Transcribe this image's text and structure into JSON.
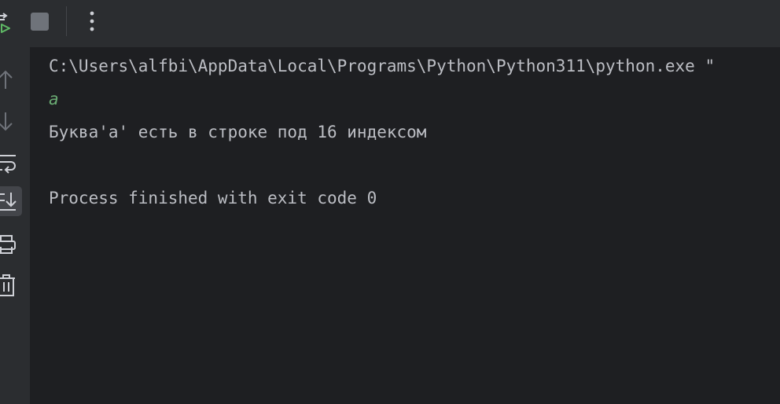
{
  "toolbar": {
    "buttons": [
      {
        "icon": "rerun-icon",
        "label": "Rerun"
      },
      {
        "icon": "stop-icon",
        "label": "Stop"
      },
      {
        "icon": "more-vertical-icon",
        "label": "More"
      }
    ]
  },
  "sidebar": {
    "items": [
      {
        "icon": "arrow-up-icon"
      },
      {
        "icon": "arrow-down-icon"
      },
      {
        "icon": "soft-wrap-icon"
      },
      {
        "icon": "scroll-to-end-icon",
        "active": true
      },
      {
        "icon": "print-icon"
      },
      {
        "icon": "trash-icon"
      }
    ]
  },
  "console": {
    "command": "C:\\Users\\alfbi\\AppData\\Local\\Programs\\Python\\Python311\\python.exe \"",
    "user_input": "a",
    "output_line": "Буква'а' есть в строке под 16 индексом",
    "exit_message": "Process finished with exit code 0"
  },
  "colors": {
    "background": "#1e1f22",
    "panel": "#2b2d30",
    "text": "#bcbec4",
    "input_text": "#6aab73",
    "run_green": "#5fb865",
    "icon": "#ced0d6",
    "icon_disabled": "#6f737a"
  }
}
